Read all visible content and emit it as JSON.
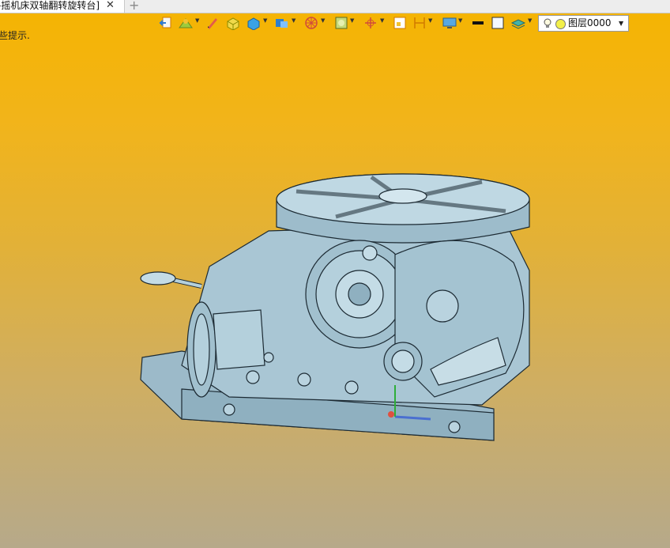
{
  "tab": {
    "title": "-摇机床双轴翻转旋转台]",
    "close_glyph": "✕"
  },
  "new_tab_glyph": "+",
  "status_hint": "些提示.",
  "layer": {
    "name": "图层0000"
  },
  "toolbar": {
    "icons": [
      "exit-sketch-icon",
      "paint-icon",
      "pen-icon",
      "box-icon",
      "solid-icon",
      "extrude-icon",
      "wheel-icon",
      "target-icon",
      "frame-icon",
      "sketch-icon",
      "dimension-icon",
      "monitor-icon",
      "black-color-icon",
      "white-color-icon",
      "layer-stack-icon"
    ]
  },
  "colors": {
    "background_top": "#f5b400",
    "background_bottom": "#b6a98a",
    "model": "#a9c6d4"
  }
}
